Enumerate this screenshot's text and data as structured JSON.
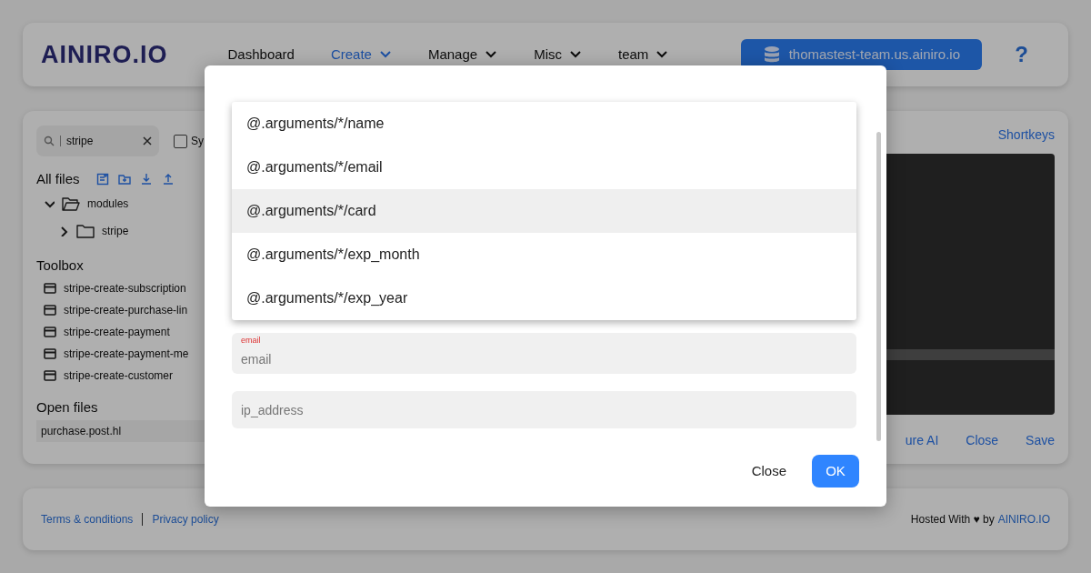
{
  "navbar": {
    "logo": "AINIRO.IO",
    "menu": [
      {
        "label": "Dashboard",
        "selected": false,
        "dropdown": false
      },
      {
        "label": "Create",
        "selected": true,
        "dropdown": true
      },
      {
        "label": "Manage",
        "selected": false,
        "dropdown": true
      },
      {
        "label": "Misc",
        "selected": false,
        "dropdown": true
      },
      {
        "label": "team",
        "selected": false,
        "dropdown": true
      }
    ],
    "cloudlet_button": "thomastest-team.us.ainiro.io",
    "help": "?"
  },
  "sidebar": {
    "search": {
      "value": "stripe"
    },
    "checkbox": {
      "label": "Sy",
      "checked": false
    },
    "files_title": "All files",
    "tree": [
      {
        "label": "modules",
        "expanded": true,
        "children": [
          {
            "label": "stripe",
            "expanded": false
          }
        ]
      }
    ],
    "toolbox_title": "Toolbox",
    "toolbox": [
      "stripe-create-subscription",
      "stripe-create-purchase-lin",
      "stripe-create-payment",
      "stripe-create-payment-me",
      "stripe-create-customer"
    ],
    "open_files_title": "Open files",
    "open_files": [
      "purchase.post.hl"
    ]
  },
  "editor": {
    "shortkeys": "Shortkeys",
    "actions": [
      "ure AI",
      "Close",
      "Save"
    ]
  },
  "modal": {
    "suggestions": [
      {
        "text": "@.arguments/*/name",
        "selected": false
      },
      {
        "text": "@.arguments/*/email",
        "selected": false
      },
      {
        "text": "@.arguments/*/card",
        "selected": true
      },
      {
        "text": "@.arguments/*/exp_month",
        "selected": false
      },
      {
        "text": "@.arguments/*/exp_year",
        "selected": false
      }
    ],
    "fields": [
      {
        "label": "email",
        "placeholder": "email"
      },
      {
        "placeholder": "ip_address"
      }
    ],
    "buttons": [
      {
        "label": "Close",
        "kind": "link"
      },
      {
        "label": "OK",
        "kind": "primary"
      }
    ]
  },
  "footer": {
    "links": [
      "Terms & conditions",
      "Privacy policy"
    ],
    "hosted": "Hosted With ♥ by",
    "brand_link": "AINIRO.IO"
  }
}
